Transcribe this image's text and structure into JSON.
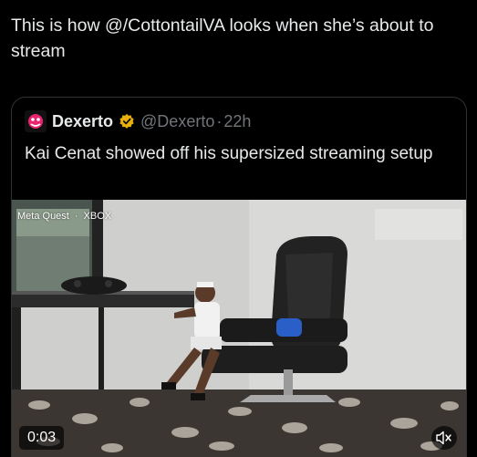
{
  "tweet": {
    "text": "This is how @/CottontailVA looks when she’s about to stream"
  },
  "quote": {
    "author_name": "Dexerto",
    "handle": "@Dexerto",
    "separator": "·",
    "time": "22h",
    "text": "Kai Cenat showed off his supersized streaming setup",
    "verified_color": "#f4b400"
  },
  "video": {
    "sponsor_meta": "Meta Quest",
    "sponsor_dot": "·",
    "sponsor_xbox": "XBOX",
    "timestamp": "0:03",
    "mute_icon": "speaker-muted-icon"
  }
}
